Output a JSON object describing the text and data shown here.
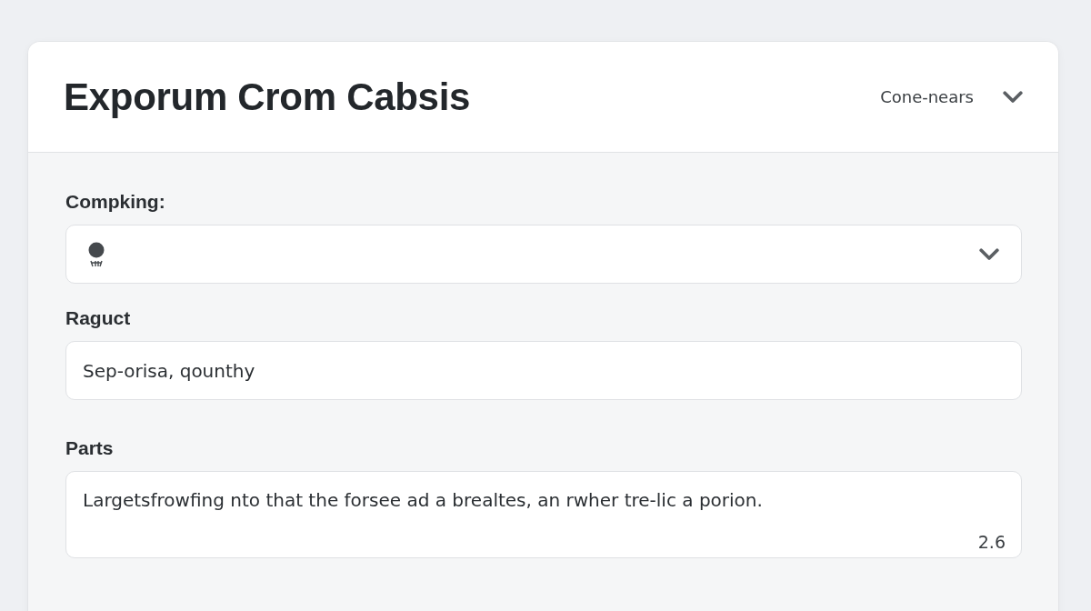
{
  "header": {
    "title": "Exporum Crom Cabsis",
    "menu_button": {
      "label": "Cone-nears"
    }
  },
  "fields": [
    {
      "kind": "select",
      "label": "Compking:"
    },
    {
      "kind": "input",
      "label": "Raguct",
      "value": "Sep-orisa, qounthy"
    },
    {
      "kind": "textarea",
      "label": "Parts",
      "value": "Largetsfrowfing nto that the forsee ad a brealtes, an rwher tre-lic a porion.",
      "counter": "2.6"
    }
  ]
}
